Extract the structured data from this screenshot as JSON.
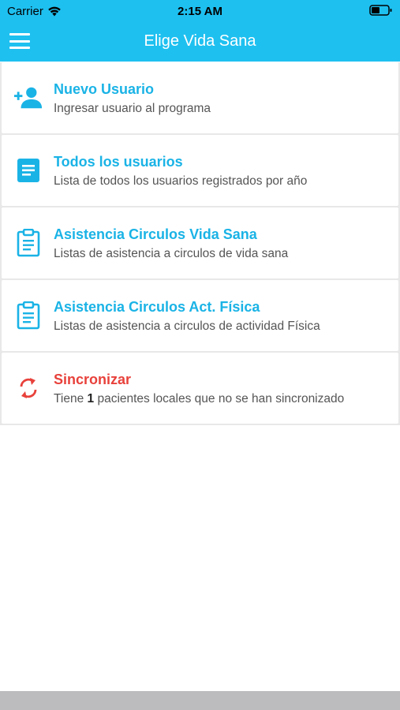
{
  "status_bar": {
    "carrier": "Carrier",
    "time": "2:15 AM",
    "wifi_icon": "wifi-icon",
    "battery_icon": "battery-icon"
  },
  "nav": {
    "title": "Elige Vida Sana",
    "menu_icon": "hamburger-menu-icon"
  },
  "colors": {
    "accent": "#1ec0f0",
    "title_blue": "#1ab3e6",
    "title_red": "#e8413b",
    "bottom_bar": "#bcbcbe"
  },
  "menu_items": [
    {
      "icon": "add-user-icon",
      "title": "Nuevo Usuario",
      "subtitle": "Ingresar usuario al programa"
    },
    {
      "icon": "document-list-icon",
      "title": "Todos los usuarios",
      "subtitle": "Lista de todos los usuarios registrados por año"
    },
    {
      "icon": "clipboard-icon",
      "title": "Asistencia Circulos Vida Sana",
      "subtitle": "Listas de asistencia a circulos de vida sana"
    },
    {
      "icon": "clipboard-icon",
      "title": "Asistencia Circulos Act. Física",
      "subtitle": "Listas de asistencia a circulos de actividad Física"
    },
    {
      "icon": "sync-icon",
      "title": "Sincronizar",
      "subtitle_prefix": "Tiene ",
      "subtitle_count": "1",
      "subtitle_suffix": " pacientes locales que no se han sincronizado"
    }
  ]
}
